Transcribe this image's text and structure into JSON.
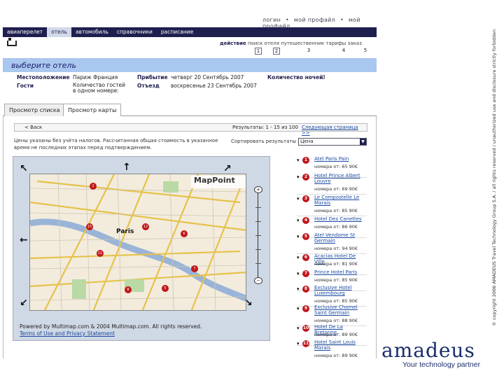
{
  "header": {
    "links": [
      "логин",
      "•",
      "мой профайл",
      "•",
      "мой профайл"
    ]
  },
  "nav": {
    "tabs": [
      "авиаперелет",
      "отель",
      "автомобиль",
      "справочники",
      "расписание"
    ],
    "active_index": 1
  },
  "steps": {
    "actions_label": "действие",
    "actions_text": "поиск   отеля   путешественник   тарифы   заказ",
    "numbers": [
      "1",
      "2",
      "3",
      "4",
      "5"
    ],
    "current_step": 2
  },
  "banner": {
    "title": "выберите отель"
  },
  "search_info": {
    "location_label": "Местоположение",
    "location_value": "Париж Франция",
    "arrival_label": "Прибытие",
    "arrival_value": "четверг 20 Сентябрь 2007",
    "nights_label": "Количество ночей",
    "nights_value": "3",
    "guests_label": "Гости",
    "guests_value": "Количество гостей в одном номере:",
    "departure_label": "Отъезд",
    "departure_value": "воскресенье 23 Сентябрь 2007"
  },
  "view_tabs": [
    "Просмотр списка",
    "Просмотр карты"
  ],
  "view_tabs_active": 1,
  "pager": {
    "back": "< Васк",
    "results": "Результаты: 1 - 15 из 100",
    "next": "Следующая страница >>"
  },
  "note": "Цены указаны без учёта налогов. Рассчитанная общая стоимость в указанное время не последних этапах перед подтверждением.",
  "sort": {
    "label": "Сортировать результаты по:",
    "value": "Цена"
  },
  "map": {
    "brand": "MapPoint",
    "city_label": "Paris",
    "powered_line": "Powered by Multimap.com & 2004 Multimap.com. All rights reserved.",
    "terms_line": "Terms of Use and Privacy Statement"
  },
  "hotels": [
    {
      "num": "1",
      "name": "Atel Paris Pain",
      "price": "номера от: 65 90€"
    },
    {
      "num": "2",
      "name": "Hotel Prince Albert Louvre",
      "price": "номера от: 69 90€"
    },
    {
      "num": "3",
      "name": "Le Compostelle Le Marais",
      "price": "номера от: 85 90€"
    },
    {
      "num": "4",
      "name": "Hotel Des Canettes",
      "price": "номера от: 86 90€"
    },
    {
      "num": "5",
      "name": "Atel Vendome St Germain",
      "price": "номера от: 94 90€"
    },
    {
      "num": "6",
      "name": "Acacias Hotel De Ville",
      "price": "номера от: 81 90€"
    },
    {
      "num": "7",
      "name": "Prince Hotel Paris",
      "price": "номера от: 85 90€"
    },
    {
      "num": "8",
      "name": "Exclusive Hotel Luxembourg",
      "price": "номера от: 85 90€"
    },
    {
      "num": "9",
      "name": "Exclusive Chomel Saint Germain",
      "price": "номера от: 88 90€"
    },
    {
      "num": "10",
      "name": "Hotel De La Bretonne",
      "price": "номера от: 89 90€"
    },
    {
      "num": "11",
      "name": "Hotel Saint Louis Marais",
      "price": "номера от: 89 90€"
    }
  ],
  "copyright": "© copyright 2006 AMADEUS Travel Technology Group S.A. / all rights reserved / unauthorized use and disclosure strictly forbidden",
  "brand": {
    "logo": "amadeus",
    "tagline": "Your technology partner",
    "color": "#1a2d6b"
  },
  "colors": {
    "navbar": "#1f1f4f",
    "banner": "#a9c7ef",
    "pin": "#c0171b"
  }
}
